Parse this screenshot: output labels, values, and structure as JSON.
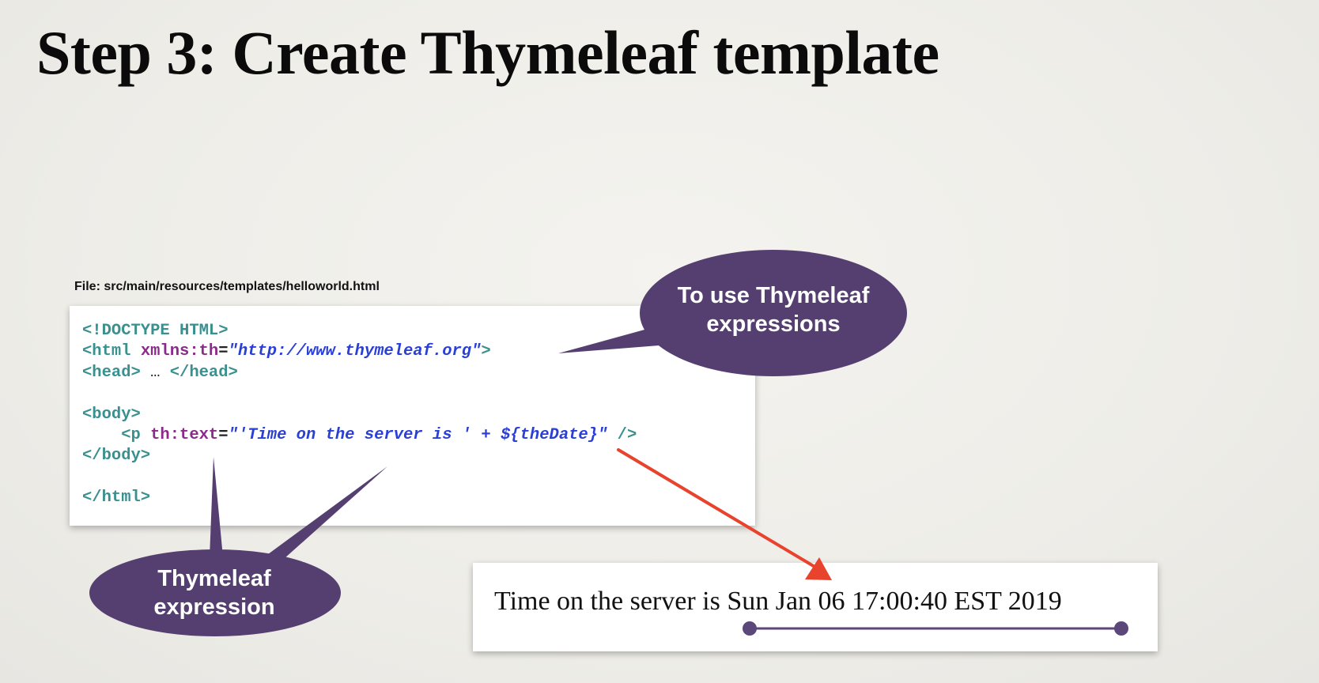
{
  "slide": {
    "title": "Step 3: Create Thymeleaf template"
  },
  "file_label": "File: src/main/resources/templates/helloworld.html",
  "code": {
    "line1_tag": "<!DOCTYPE HTML>",
    "line2_tag_open": "<html ",
    "line2_attr": "xmlns:th",
    "line2_eq": "=",
    "line2_value": "\"http://www.thymeleaf.org\"",
    "line2_tag_close": ">",
    "line3_open": "<head>",
    "line3_ellipsis": " … ",
    "line3_close": "</head>",
    "line5_tag": "<body>",
    "line6_indent": "    ",
    "line6_tag_open": "<p ",
    "line6_attr": "th:text",
    "line6_eq": "=",
    "line6_value": "\"'Time on the server is ' + ${theDate}\"",
    "line6_tag_close": " />",
    "line7_tag": "</body>",
    "line9_tag": "</html>"
  },
  "output": {
    "text": "Time on the server is Sun Jan 06 17:00:40 EST 2019"
  },
  "callouts": {
    "top_line1": "To use Thymeleaf",
    "top_line2": "expressions",
    "bottom_line1": "Thymeleaf",
    "bottom_line2": "expression"
  },
  "colors": {
    "callout_fill": "#553f70",
    "arrow": "#e8432d",
    "underline": "#5b4779",
    "code_tag": "#3a8f8f",
    "code_attr": "#8b2a8b",
    "code_string": "#2a3fd6"
  }
}
